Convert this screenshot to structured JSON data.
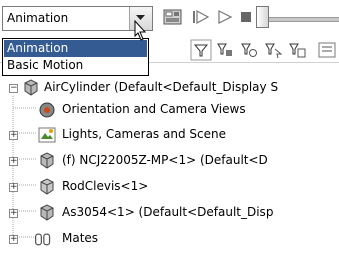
{
  "toolbar": {
    "mode_selected": "Animation",
    "dropdown_options": [
      "Animation",
      "Basic Motion"
    ]
  },
  "tree": {
    "root": "AirCylinder  (Default<Default_Display S",
    "items": [
      "Orientation and Camera Views",
      "Lights, Cameras and Scene",
      "(f) NCJ22005Z-MP<1> (Default<D",
      "RodClevis<1>",
      "As3054<1> (Default<Default_Disp",
      "Mates"
    ]
  },
  "colors": {
    "selection": "#345b92",
    "icon_green": "#4a8a2a",
    "icon_gray": "#6a6a6a"
  }
}
